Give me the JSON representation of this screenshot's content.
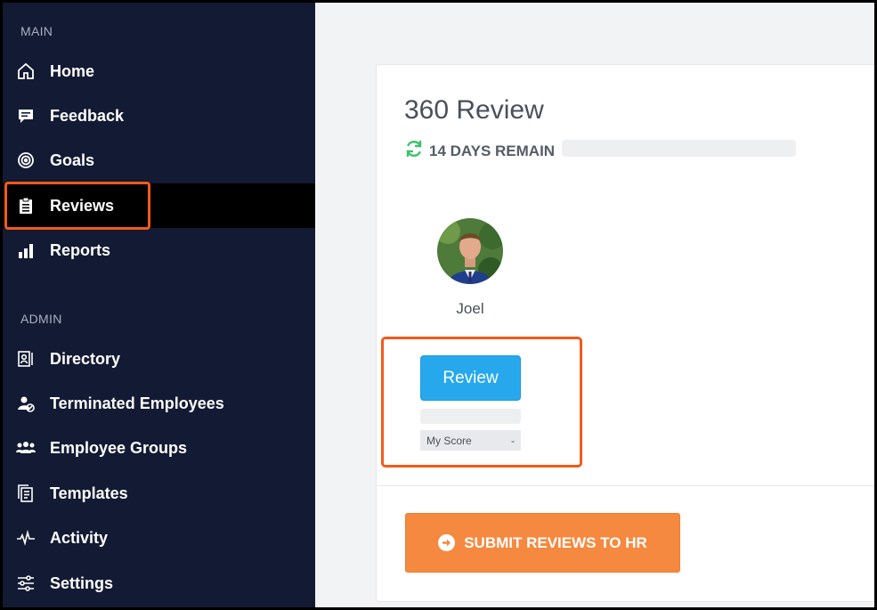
{
  "sidebar": {
    "main_label": "MAIN",
    "admin_label": "ADMIN",
    "main_items": [
      {
        "label": "Home",
        "icon": "home-icon"
      },
      {
        "label": "Feedback",
        "icon": "feedback-icon"
      },
      {
        "label": "Goals",
        "icon": "goals-icon"
      },
      {
        "label": "Reviews",
        "icon": "clipboard-icon",
        "active": true
      },
      {
        "label": "Reports",
        "icon": "bar-chart-icon"
      }
    ],
    "admin_items": [
      {
        "label": "Directory",
        "icon": "directory-icon"
      },
      {
        "label": "Terminated Employees",
        "icon": "terminated-user-icon"
      },
      {
        "label": "Employee Groups",
        "icon": "groups-icon"
      },
      {
        "label": "Templates",
        "icon": "templates-icon"
      },
      {
        "label": "Activity",
        "icon": "activity-icon"
      },
      {
        "label": "Settings",
        "icon": "settings-sliders-icon"
      }
    ]
  },
  "main": {
    "title": "360 Review",
    "remaining": "14 DAYS REMAIN",
    "reviewee": {
      "name": "Joel",
      "review_label": "Review",
      "score_label": "My Score",
      "score_value": "-"
    },
    "submit_label": "SUBMIT REVIEWS TO HR"
  },
  "colors": {
    "sidebar_bg": "#131a33",
    "accent_blue": "#27a8ed",
    "accent_orange": "#f5893f",
    "highlight": "#f25a1a",
    "refresh_green": "#3cc26a"
  }
}
